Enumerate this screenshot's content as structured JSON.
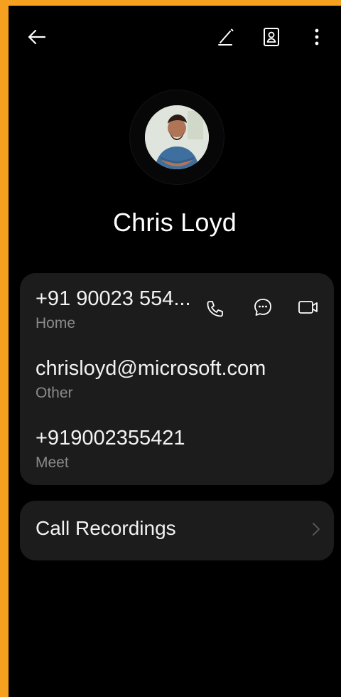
{
  "topbar": {
    "back_icon": "arrow-left-icon",
    "edit_icon": "edit-pencil-icon",
    "contact_card_icon": "contact-card-icon",
    "more_icon": "more-vertical-icon"
  },
  "contact": {
    "name": "Chris Loyd"
  },
  "entries": [
    {
      "value": "+91 90023 554...",
      "label": "Home"
    },
    {
      "value": "chrisloyd@microsoft.com",
      "label": "Other"
    },
    {
      "value": "+919002355421",
      "label": "Meet"
    }
  ],
  "actions": [
    "phone-icon",
    "message-icon",
    "video-icon"
  ],
  "recordings": {
    "label": "Call Recordings",
    "chevron": "chevron-right-icon"
  },
  "colors": {
    "frame": "#F5A01F",
    "background": "#000000",
    "card": "#1c1c1c",
    "text": "#f2f2f2",
    "secondary_text": "#8a8a8a"
  }
}
